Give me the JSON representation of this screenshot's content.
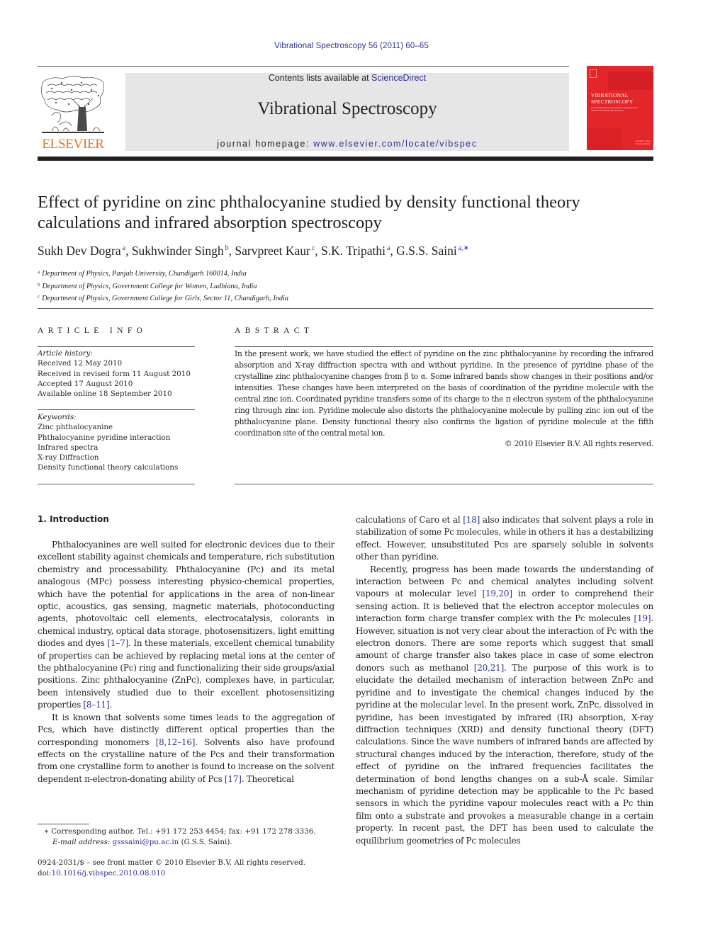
{
  "header": {
    "citation": "Vibrational Spectroscopy 56 (2011) 60–65",
    "contents_prefix": "Contents lists available at ",
    "contents_link": "ScienceDirect",
    "journal_name": "Vibrational Spectroscopy",
    "homepage_prefix": "journal homepage: ",
    "homepage_link": "www.elsevier.com/locate/vibspec",
    "publisher_logo": "ELSEVIER",
    "cover": {
      "title_line1": "VIBRATIONAL",
      "title_line2": "SPECTROSCOPY",
      "subtitle": "An international journal devoted to applications of Infrared and Raman Spectroscopy",
      "footer": "Available online at ScienceDirect",
      "color": "#e3262a"
    }
  },
  "article": {
    "title": "Effect of pyridine on zinc phthalocyanine studied by density functional theory calculations and infrared absorption spectroscopy",
    "authors": [
      {
        "name": "Sukh Dev Dogra",
        "sup": "a"
      },
      {
        "name": "Sukhwinder Singh",
        "sup": "b"
      },
      {
        "name": "Sarvpreet Kaur",
        "sup": "c"
      },
      {
        "name": "S.K. Tripathi",
        "sup": "a"
      },
      {
        "name": "G.S.S. Saini",
        "sup": "a,∗"
      }
    ],
    "affiliations": [
      {
        "key": "a",
        "text": "Department of Physics, Panjab University, Chandigarh 160014, India"
      },
      {
        "key": "b",
        "text": "Department of Physics, Government College for Women, Ludhiana, India"
      },
      {
        "key": "c",
        "text": "Department of Physics, Government College for Girls, Sector 11, Chandigarh, India"
      }
    ]
  },
  "article_info": {
    "heading": "ARTICLE INFO",
    "history_label": "Article history:",
    "history": [
      "Received 12 May 2010",
      "Received in revised form 11 August 2010",
      "Accepted 17 August 2010",
      "Available online 18 September 2010"
    ],
    "keywords_label": "Keywords:",
    "keywords": [
      "Zinc phthalocyanine",
      "Phthalocyanine pyridine interaction",
      "Infrared spectra",
      "X-ray Diffraction",
      "Density functional theory calculations"
    ]
  },
  "abstract": {
    "heading": "ABSTRACT",
    "text": "In the present work, we have studied the effect of pyridine on the zinc phthalocyanine by recording the infrared absorption and X-ray diffraction spectra with and without pyridine. In the presence of pyridine phase of the crystalline zinc phthalocyanine changes from β to α. Some infrared bands show changes in their positions and/or intensities. These changes have been interpreted on the basis of coordination of the pyridine molecule with the central zinc ion. Coordinated pyridine transfers some of its charge to the π electron system of the phthalocyanine ring through zinc ion. Pyridine molecule also distorts the phthalocyanine molecule by pulling zinc ion out of the phthalocyanine plane. Density functional theory also confirms the ligation of pyridine molecule at the fifth coordination site of the central metal ion.",
    "copyright": "© 2010 Elsevier B.V. All rights reserved."
  },
  "body": {
    "section_heading": "1.  Introduction",
    "left": {
      "p1_a": "Phthalocyanines are well suited for electronic devices due to their excellent stability against chemicals and temperature, rich substitution chemistry and processability. Phthalocyanine (Pc) and its metal analogous (MPc) possess interesting physico-chemical properties, which have the potential for applications in the area of non-linear optic, acoustics, gas sensing, magnetic materials, photoconducting agents, photovoltaic cell elements, electrocatalysis, colorants in chemical industry, optical data storage, photosensitizers, light emitting diodes and dyes ",
      "p1_ref1": "[1–7]",
      "p1_b": ". In these materials, excellent chemical tunability of properties can be achieved by replacing metal ions at the center of the phthalocyanine (Pc) ring and functionalizing their side groups/axial positions. Zinc phthalocyanine (ZnPc), complexes have, in particular, been intensively studied due to their excellent photosensitizing properties ",
      "p1_ref2": "[8–11]",
      "p1_c": ".",
      "p2_a": "It is known that solvents some times leads to the aggregation of Pcs, which have distinctly different optical properties than the corresponding monomers ",
      "p2_ref1": "[8,12–16]",
      "p2_b": ". Solvents also have profound effects on the crystalline nature of the Pcs and their transformation from one crystalline form to another is found to increase on the solvent dependent π-electron-donating ability of Pcs ",
      "p2_ref2": "[17]",
      "p2_c": ". Theoretical"
    },
    "right": {
      "p1_a": "calculations of Caro et al ",
      "p1_ref1": "[18]",
      "p1_b": " also indicates that solvent plays a role in stabilization of some Pc molecules, while in others it has a destabilizing effect. However, unsubstituted Pcs are sparsely soluble in solvents other than pyridine.",
      "p2_a": "Recently, progress has been made towards the understanding of interaction between Pc and chemical analytes including solvent vapours at molecular level ",
      "p2_ref1": "[19,20]",
      "p2_b": " in order to comprehend their sensing action. It is believed that the electron acceptor molecules on interaction form charge transfer complex with the Pc molecules ",
      "p2_ref2": "[19]",
      "p2_c": ". However, situation is not very clear about the interaction of Pc with the electron donors. There are some reports which suggest that small amount of charge transfer also takes place in case of some electron donors such as methanol ",
      "p2_ref3": "[20,21]",
      "p2_d": ". The purpose of this work is to elucidate the detailed mechanism of interaction between ZnPc and pyridine and to investigate the chemical changes induced by the pyridine at the molecular level. In the present work, ZnPc, dissolved in pyridine, has been investigated by infrared (IR) absorption, X-ray diffraction techniques (XRD) and density functional theory (DFT) calculations. Since the wave numbers of infrared bands are affected by structural changes induced by the interaction, therefore, study of the effect of pyridine on the infrared frequencies facilitates the determination of bond lengths changes on a sub-Å scale. Similar mechanism of pyridine detection may be applicable to the Pc based sensors in which the pyridine vapour molecules react with a Pc thin film onto a substrate and provokes a measurable change in a certain property. In recent past, the DFT has been used to calculate the equilibrium geometries of Pc molecules"
    }
  },
  "footnote": {
    "star": "∗",
    "corresponding": " Corresponding author. Tel.: +91 172 253 4454; fax: +91 172 278 3336.",
    "email_label": "E-mail address: ",
    "email": "gsssaini@pu.ac.in",
    "email_suffix": " (G.S.S. Saini)."
  },
  "front_matter": {
    "issn_line": "0924-2031/$ – see front matter © 2010 Elsevier B.V. All rights reserved.",
    "doi_prefix": "doi:",
    "doi": "10.1016/j.vibspec.2010.08.010"
  },
  "colors": {
    "link": "#2e3192",
    "elsevier_orange": "#e9711c",
    "masthead_gray": "#e6e6e6",
    "text": "#231f20"
  }
}
